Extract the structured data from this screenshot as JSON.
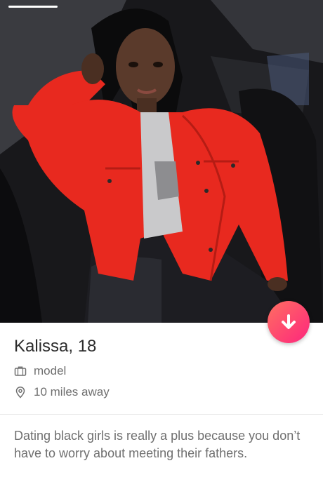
{
  "profile": {
    "name": "Kalissa",
    "age_text": ", 18",
    "job": "model",
    "distance": "10 miles away",
    "bio": "Dating black girls is really a plus because you don’t have to worry about meeting their fathers."
  },
  "icons": {
    "job": "briefcase-icon",
    "distance": "location-pin-icon",
    "action": "arrow-down-icon"
  },
  "colors": {
    "accent_start": "#ff6f61",
    "accent_end": "#fd267d"
  }
}
